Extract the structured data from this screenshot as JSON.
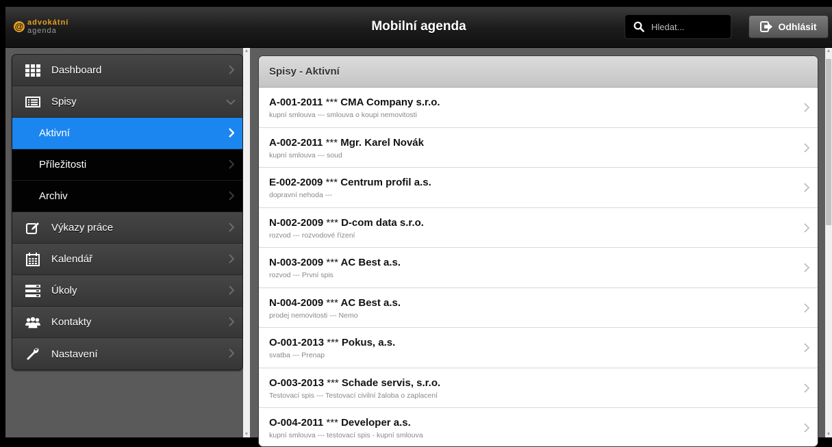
{
  "header": {
    "logo_line1": "advokátní",
    "logo_line2": "agenda",
    "title": "Mobilní agenda",
    "search_placeholder": "Hledat...",
    "logout_label": "Odhlásit"
  },
  "menu": [
    {
      "label": "Dashboard",
      "icon": "grid-icon",
      "type": "main",
      "chevron": "right"
    },
    {
      "label": "Spisy",
      "icon": "list-card-icon",
      "type": "main",
      "chevron": "down"
    },
    {
      "label": "Aktivní",
      "icon": "",
      "type": "sub-active",
      "chevron": "right"
    },
    {
      "label": "Příležitosti",
      "icon": "",
      "type": "sub",
      "chevron": "right"
    },
    {
      "label": "Archiv",
      "icon": "",
      "type": "sub",
      "chevron": "right"
    },
    {
      "label": "Výkazy práce",
      "icon": "edit-icon",
      "type": "main",
      "chevron": "right"
    },
    {
      "label": "Kalendář",
      "icon": "calendar-icon",
      "type": "main",
      "chevron": "right"
    },
    {
      "label": "Úkoly",
      "icon": "tasks-icon",
      "type": "main",
      "chevron": "right"
    },
    {
      "label": "Kontakty",
      "icon": "contacts-icon",
      "type": "main",
      "chevron": "right"
    },
    {
      "label": "Nastavení",
      "icon": "wrench-icon",
      "type": "main",
      "chevron": "right"
    }
  ],
  "list": {
    "header": "Spisy - Aktivní",
    "items": [
      {
        "code": "A-001-2011",
        "stars": "***",
        "name": "CMA Company s.r.o.",
        "subtitle": "kupní smlouva --- smlouva o koupi nemovitosti"
      },
      {
        "code": "A-002-2011",
        "stars": "***",
        "name": "Mgr. Karel Novák",
        "subtitle": "kupní smlouva --- soud"
      },
      {
        "code": "E-002-2009",
        "stars": "***",
        "name": "Centrum profil a.s.",
        "subtitle": "dopravní nehoda ---"
      },
      {
        "code": "N-002-2009",
        "stars": "***",
        "name": "D-com data s.r.o.",
        "subtitle": "rozvod --- rozvodové řízení"
      },
      {
        "code": "N-003-2009",
        "stars": "***",
        "name": "AC Best a.s.",
        "subtitle": "rozvod --- První spis"
      },
      {
        "code": "N-004-2009",
        "stars": "***",
        "name": "AC Best a.s.",
        "subtitle": "prodej nemovitosti --- Nemo"
      },
      {
        "code": "O-001-2013",
        "stars": "***",
        "name": "Pokus, a.s.",
        "subtitle": "svatba --- Prenap"
      },
      {
        "code": "O-003-2013",
        "stars": "***",
        "name": "Schade servis, s.r.o.",
        "subtitle": "Testovací spis --- Testovací civilní žaloba o zaplacení"
      },
      {
        "code": "O-004-2011",
        "stars": "***",
        "name": "Developer a.s.",
        "subtitle": "kupní smlouva --- testovací spis - kupní smlouva"
      }
    ]
  },
  "colors": {
    "active": "#1b86f0",
    "logo_accent": "#e8a020"
  }
}
